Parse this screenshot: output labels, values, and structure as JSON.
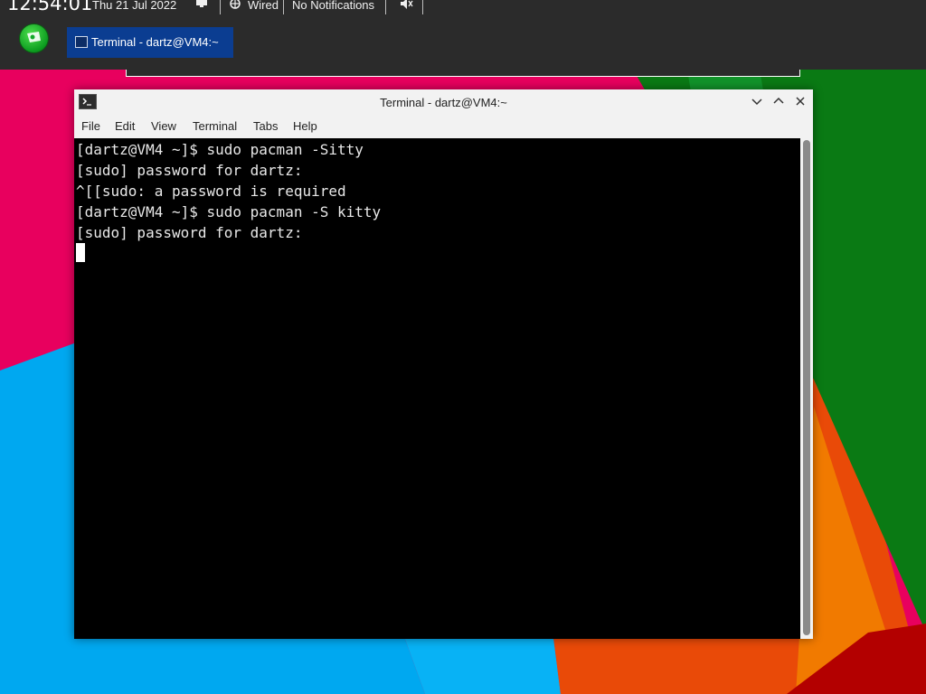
{
  "panel": {
    "clock": "12:54:01",
    "date": "Thu 21 Jul 2022",
    "network": "Wired",
    "notifications": "No Notifications",
    "taskbar_item": "Terminal - dartz@VM4:~"
  },
  "window": {
    "title": "Terminal - dartz@VM4:~",
    "menu": [
      "File",
      "Edit",
      "View",
      "Terminal",
      "Tabs",
      "Help"
    ]
  },
  "terminal": {
    "lines": [
      "[dartz@VM4 ~]$ sudo pacman -Sitty",
      "[sudo] password for dartz:",
      "^[[sudo: a password is required",
      "[dartz@VM4 ~]$ sudo pacman -S kitty",
      "[sudo] password for dartz:"
    ]
  },
  "colors": {
    "panel_bg": "#2b2b2b",
    "task_active": "#0b3d91",
    "terminal_bg": "#000000",
    "terminal_fg": "#e8e8e8"
  },
  "icons": {
    "menu": "app-menu-logo-icon",
    "screen": "display-icon",
    "network": "network-icon",
    "volume": "volume-icon",
    "terminal": "terminal-icon"
  }
}
